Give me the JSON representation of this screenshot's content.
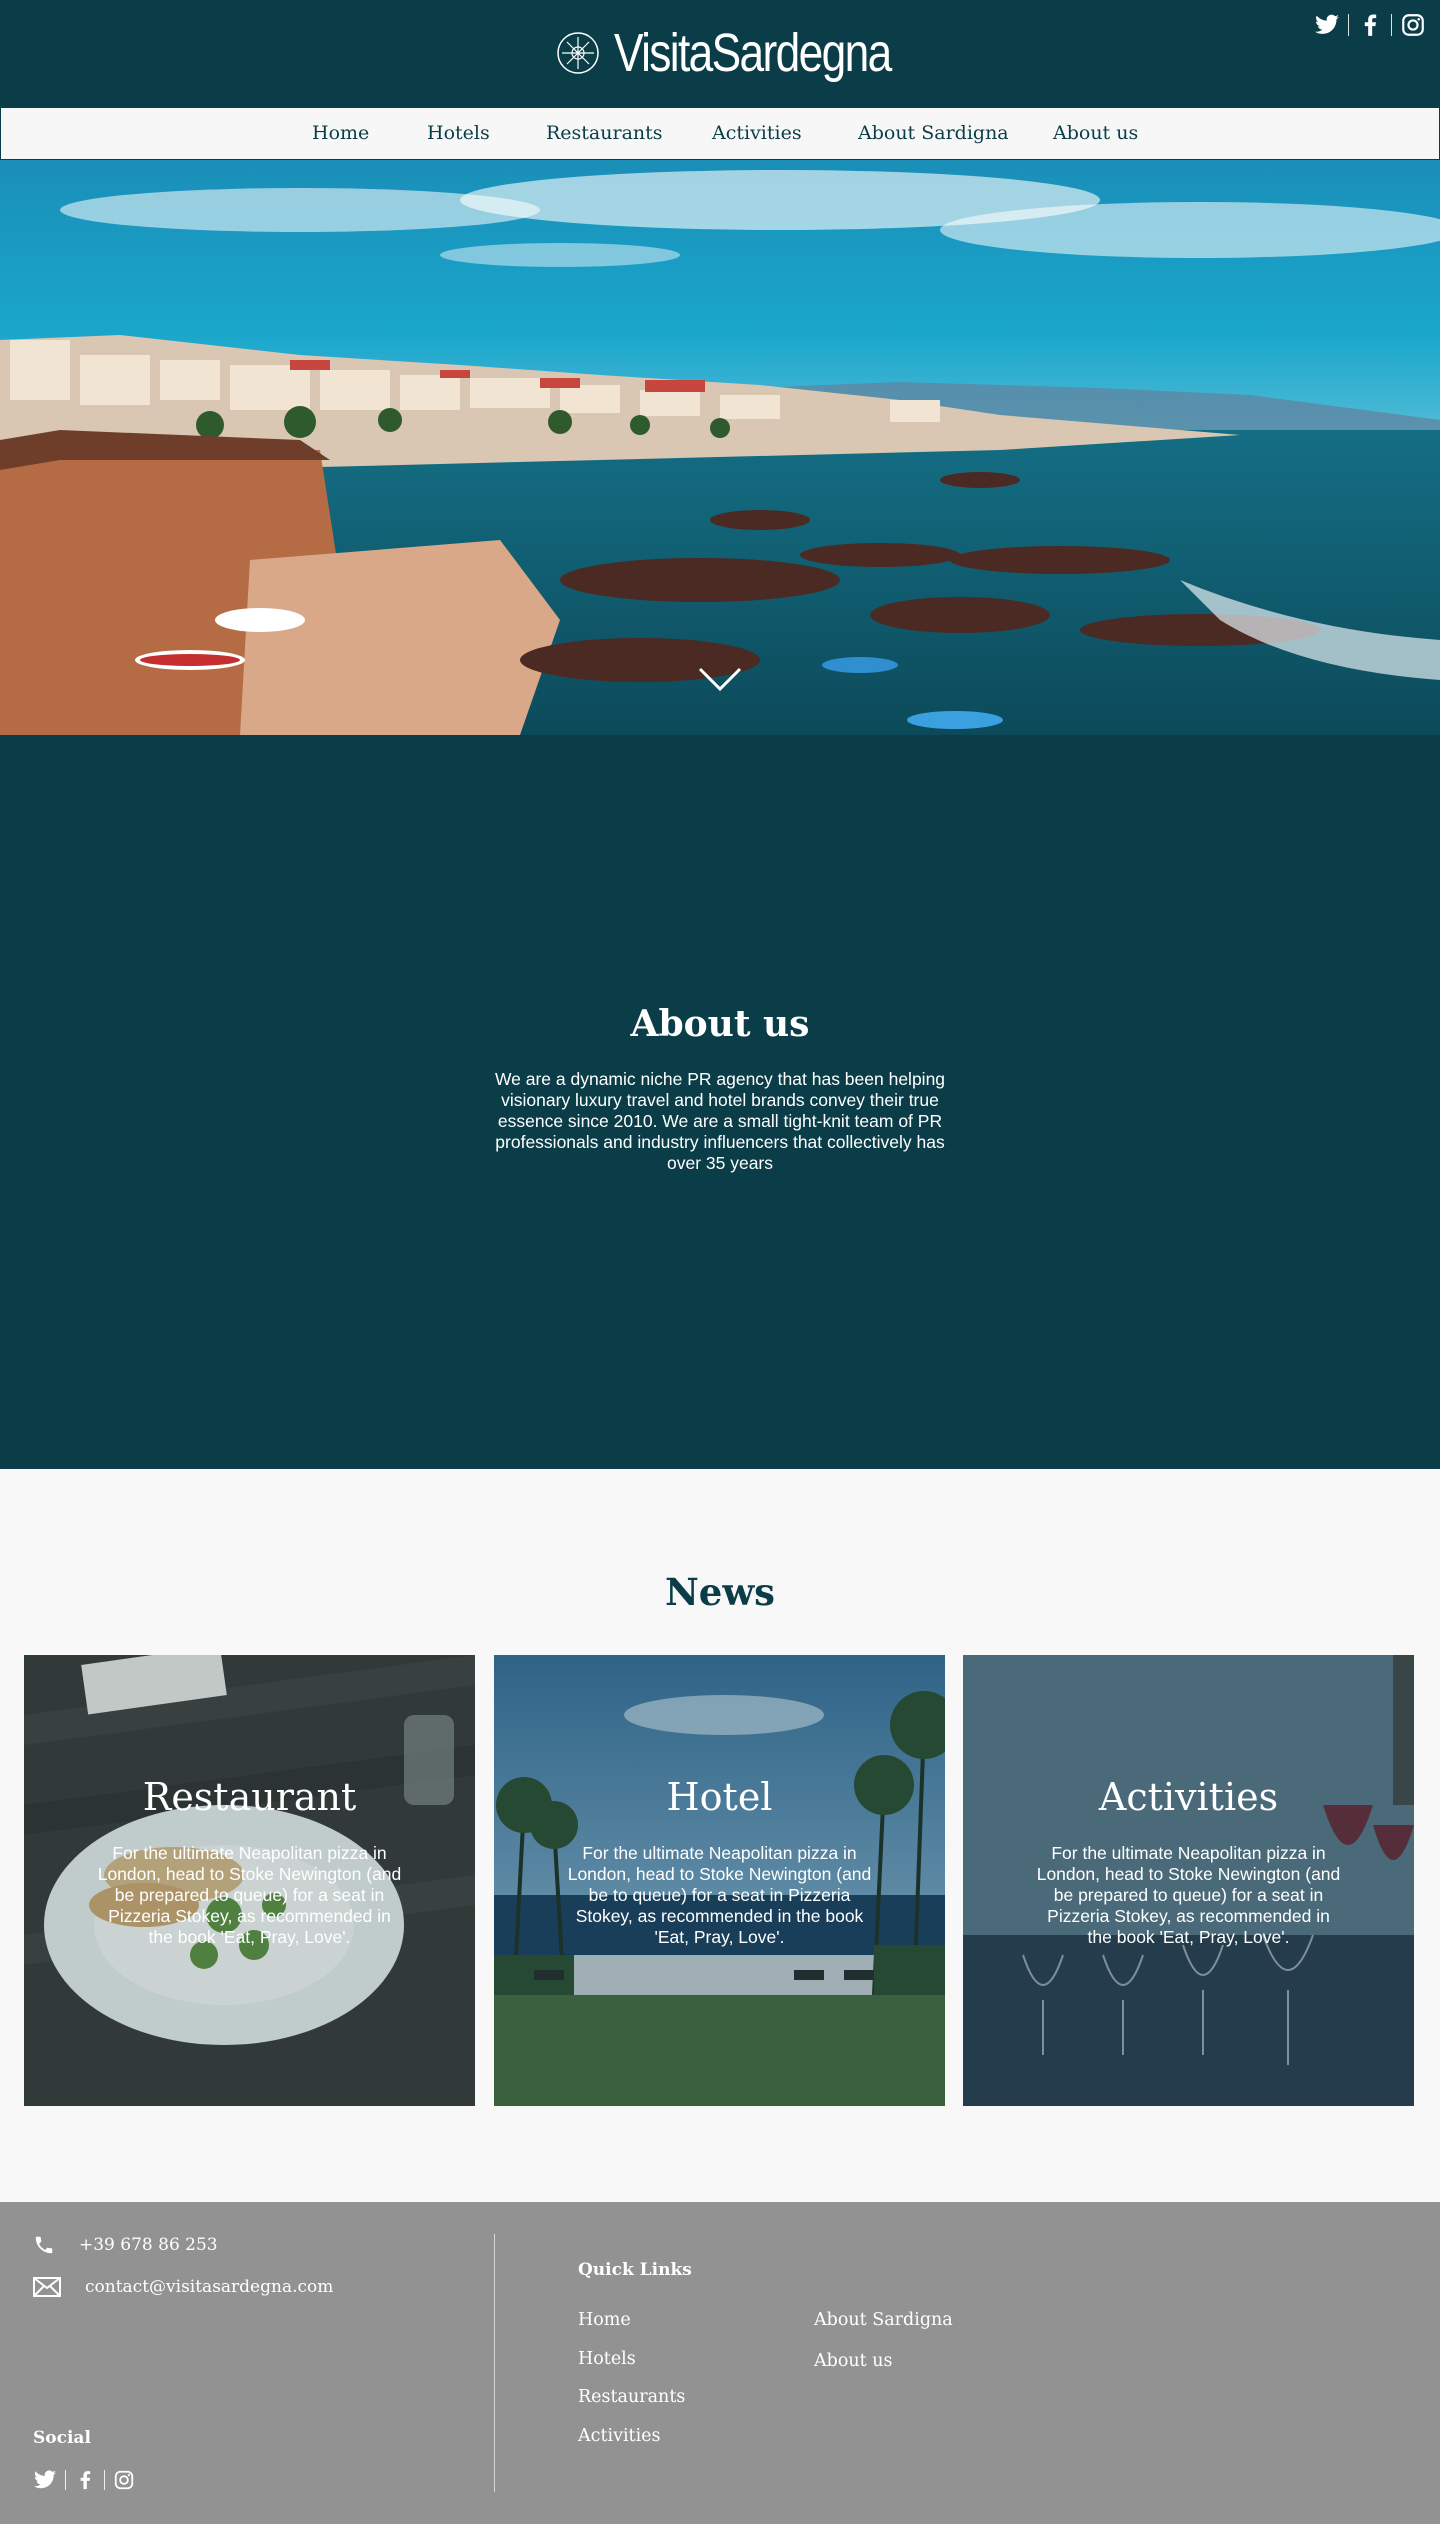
{
  "brand": {
    "name": "VisitaSardegna"
  },
  "nav": {
    "items": [
      "Home",
      "Hotels",
      "Restaurants",
      "Activities",
      "About Sardigna",
      "About us"
    ]
  },
  "hero": {
    "scroll_icon": "chevron-down-icon"
  },
  "about": {
    "title": "About us",
    "text": "We are a dynamic niche PR agency that has been helping visionary luxury travel and hotel brands convey their true essence since 2010.  We are a small tight-knit team of PR professionals and industry influencers that collectively has over 35 years"
  },
  "news": {
    "title": "News",
    "cards": [
      {
        "title": "Restaurant",
        "text": "For the ultimate Neapolitan pizza in London, head to Stoke Newington (and be prepared to queue) for a seat in Pizzeria Stokey, as recommended in the book 'Eat, Pray, Love'."
      },
      {
        "title": "Hotel",
        "text": "For the ultimate Neapolitan pizza in London, head to Stoke Newington (and be  to queue) for a seat in Pizzeria Stokey, as recommended in the book 'Eat, Pray, Love'."
      },
      {
        "title": "Activities",
        "text": "For the ultimate Neapolitan pizza in London, head to Stoke Newington (and be prepared to queue) for a seat in Pizzeria Stokey, as recommended in the book 'Eat, Pray, Love'."
      }
    ]
  },
  "footer": {
    "phone": "+39 678 86 253",
    "email": "contact@visitasardegna.com",
    "social_heading": "Social",
    "quick_links_heading": "Quick Links",
    "links_col1": [
      "Home",
      "Hotels",
      "Restaurants",
      "Activities"
    ],
    "links_col2": [
      "About Sardigna",
      "About us"
    ]
  },
  "colors": {
    "primary": "#0a3d47",
    "background": "#f8f8f8",
    "footer": "#929292"
  },
  "icons": [
    "twitter-icon",
    "facebook-icon",
    "instagram-icon",
    "phone-icon",
    "mail-icon",
    "compass-logo-icon",
    "chevron-down-icon"
  ]
}
